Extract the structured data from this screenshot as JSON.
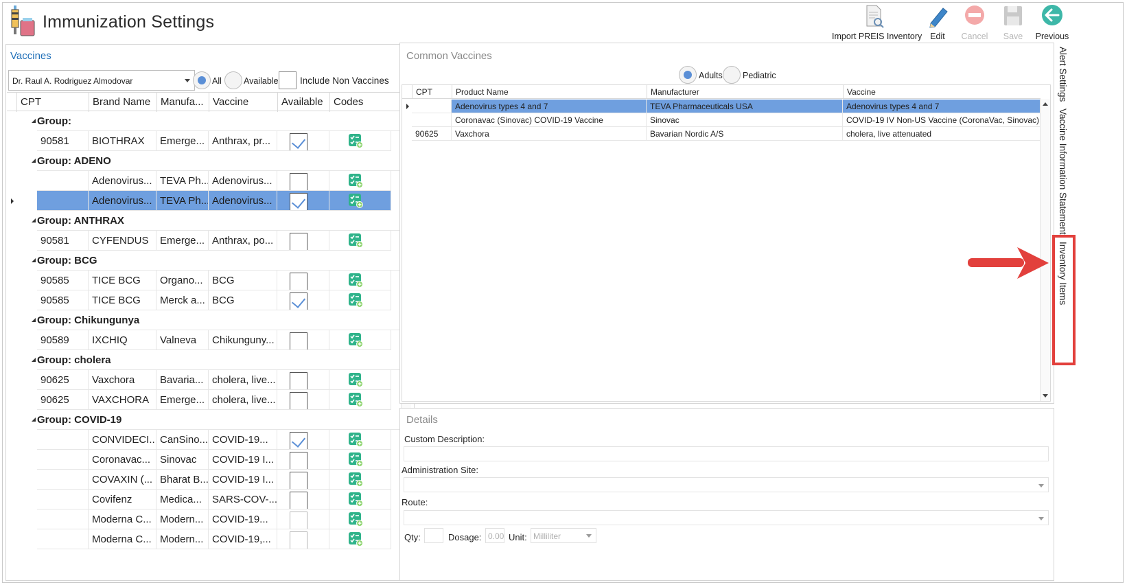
{
  "app": {
    "title": "Immunization Settings"
  },
  "toolbar": {
    "import_label": "Import PREIS Inventory",
    "edit_label": "Edit",
    "cancel_label": "Cancel",
    "save_label": "Save",
    "previous_label": "Previous"
  },
  "vaccines_panel": {
    "title": "Vaccines",
    "provider": "Dr. Raul A. Rodriguez Almodovar",
    "filter_all": "All",
    "filter_available": "Available",
    "filter_selected": "All",
    "include_non_vaccines_label": "Include Non Vaccines",
    "include_non_vaccines_checked": false,
    "columns": [
      "CPT",
      "Brand Name",
      "Manufa...",
      "Vaccine",
      "Available",
      "Codes"
    ],
    "rows": [
      {
        "type": "group",
        "label": "Group:"
      },
      {
        "type": "item",
        "cpt": "90581",
        "brand": "BIOTHRAX",
        "manufacturer": "Emerge...",
        "vaccine": "Anthrax, pr...",
        "available": true
      },
      {
        "type": "group",
        "label": "Group: ADENO"
      },
      {
        "type": "item",
        "cpt": "",
        "brand": "Adenovirus...",
        "manufacturer": "TEVA Ph...",
        "vaccine": "Adenovirus...",
        "available": false
      },
      {
        "type": "item",
        "cpt": "",
        "brand": "Adenovirus...",
        "manufacturer": "TEVA Ph...",
        "vaccine": "Adenovirus...",
        "available": true,
        "selected": true
      },
      {
        "type": "group",
        "label": "Group: ANTHRAX"
      },
      {
        "type": "item",
        "cpt": "90581",
        "brand": "CYFENDUS",
        "manufacturer": "Emerge...",
        "vaccine": "Anthrax, po...",
        "available": false
      },
      {
        "type": "group",
        "label": "Group: BCG"
      },
      {
        "type": "item",
        "cpt": "90585",
        "brand": "TICE BCG",
        "manufacturer": "Organo...",
        "vaccine": "BCG",
        "available": false
      },
      {
        "type": "item",
        "cpt": "90585",
        "brand": "TICE BCG",
        "manufacturer": "Merck a...",
        "vaccine": "BCG",
        "available": true
      },
      {
        "type": "group",
        "label": "Group: Chikungunya"
      },
      {
        "type": "item",
        "cpt": "90589",
        "brand": "IXCHIQ",
        "manufacturer": "Valneva",
        "vaccine": "Chikunguny...",
        "available": false
      },
      {
        "type": "group",
        "label": "Group: cholera"
      },
      {
        "type": "item",
        "cpt": "90625",
        "brand": "Vaxchora",
        "manufacturer": "Bavaria...",
        "vaccine": "cholera, live...",
        "available": false
      },
      {
        "type": "item",
        "cpt": "90625",
        "brand": "VAXCHORA",
        "manufacturer": "Emerge...",
        "vaccine": "cholera, live...",
        "available": false
      },
      {
        "type": "group",
        "label": "Group: COVID-19"
      },
      {
        "type": "item",
        "cpt": "",
        "brand": "CONVIDECI...",
        "manufacturer": "CanSino...",
        "vaccine": "COVID-19...",
        "available": true
      },
      {
        "type": "item",
        "cpt": "",
        "brand": "Coronavac...",
        "manufacturer": "Sinovac",
        "vaccine": "COVID-19 I...",
        "available": false
      },
      {
        "type": "item",
        "cpt": "",
        "brand": "COVAXIN (...",
        "manufacturer": "Bharat B...",
        "vaccine": "COVID-19 I...",
        "available": false
      },
      {
        "type": "item",
        "cpt": "",
        "brand": "Covifenz",
        "manufacturer": "Medica...",
        "vaccine": "SARS-COV-...",
        "available": false
      },
      {
        "type": "item",
        "cpt": "",
        "brand": "Moderna C...",
        "manufacturer": "Modern...",
        "vaccine": "COVID-19...",
        "available": false,
        "light": true
      },
      {
        "type": "item",
        "cpt": "",
        "brand": "Moderna C...",
        "manufacturer": "Modern...",
        "vaccine": "COVID-19,...",
        "available": false,
        "light": true
      }
    ]
  },
  "common_panel": {
    "title": "Common Vaccines",
    "filter_adults": "Adults",
    "filter_pediatric": "Pediatric",
    "filter_selected": "Adults",
    "columns": [
      "CPT",
      "Product Name",
      "Manufacturer",
      "Vaccine"
    ],
    "rows": [
      {
        "cpt": "",
        "product": "Adenovirus types 4 and 7",
        "manufacturer": "TEVA Pharmaceuticals USA",
        "vaccine": "Adenovirus types 4 and 7",
        "selected": true
      },
      {
        "cpt": "",
        "product": "Coronavac (Sinovac) COVID-19 Vaccine",
        "manufacturer": "Sinovac",
        "vaccine": "COVID-19 IV Non-US Vaccine (CoronaVac, Sinovac)"
      },
      {
        "cpt": "90625",
        "product": "Vaxchora",
        "manufacturer": "Bavarian Nordic A/S",
        "vaccine": "cholera, live attenuated"
      }
    ]
  },
  "details_panel": {
    "title": "Details",
    "custom_description_label": "Custom Description:",
    "administration_site_label": "Administration Site:",
    "route_label": "Route:",
    "qty_label": "Qty:",
    "dosage_label": "Dosage:",
    "dosage_value": "0.00",
    "unit_label": "Unit:",
    "unit_value": "Milliliter"
  },
  "side_tabs": {
    "alert_settings": "Alert Settings",
    "vis": "Vaccine Information Statement",
    "inventory_items": "Inventory Items"
  },
  "colors": {
    "accent_blue": "#1f6fb8",
    "selection": "#6f9fdf",
    "annotation_red": "#e2403c",
    "code_icon_green": "#2fb38a"
  }
}
